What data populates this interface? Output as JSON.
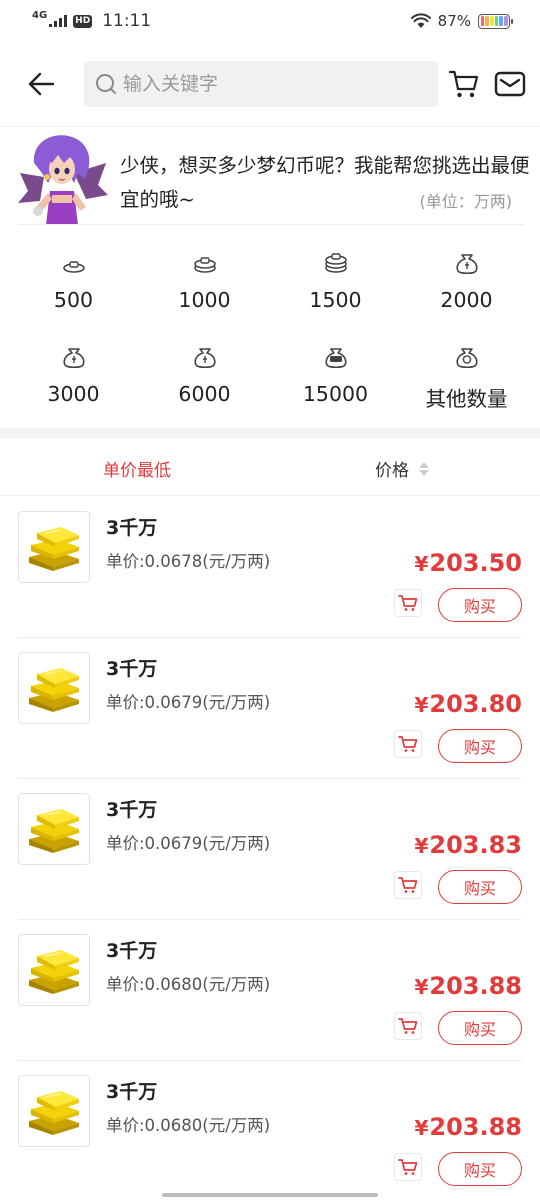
{
  "status_bar": {
    "network": "4G",
    "hd": "HD",
    "time": "11:11",
    "battery": "87%",
    "battery_colors": [
      "#f06a6a",
      "#f3b24a",
      "#f0e24a",
      "#6fcf7a",
      "#5bb0f0",
      "#b68ee8"
    ]
  },
  "header": {
    "search_placeholder": "输入关键字",
    "icons": [
      "back-arrow-icon",
      "search-icon",
      "cart-icon",
      "mail-icon"
    ]
  },
  "banner": {
    "text": "少侠，想买多少梦幻币呢？我能帮您挑选出最便宜的哦~",
    "unit": "(单位：万两)"
  },
  "amounts": [
    {
      "label": "500",
      "icon": "coin-stack-small-icon"
    },
    {
      "label": "1000",
      "icon": "coin-stack-icon"
    },
    {
      "label": "1500",
      "icon": "coin-stack-large-icon"
    },
    {
      "label": "2000",
      "icon": "money-bag-icon"
    },
    {
      "label": "3000",
      "icon": "money-bag-icon"
    },
    {
      "label": "6000",
      "icon": "money-bag-icon"
    },
    {
      "label": "15000",
      "icon": "money-bag-max-icon"
    },
    {
      "label": "其他数量",
      "icon": "money-bag-question-icon"
    }
  ],
  "sort": {
    "lowest_unit": "单价最低",
    "price": "价格"
  },
  "accent_color": "#e23b3b",
  "items": [
    {
      "title": "3千万",
      "unit_price": "单价:0.0678(元/万两)",
      "currency": "¥",
      "price": "203.50",
      "buy": "购买"
    },
    {
      "title": "3千万",
      "unit_price": "单价:0.0679(元/万两)",
      "currency": "¥",
      "price": "203.80",
      "buy": "购买"
    },
    {
      "title": "3千万",
      "unit_price": "单价:0.0679(元/万两)",
      "currency": "¥",
      "price": "203.83",
      "buy": "购买"
    },
    {
      "title": "3千万",
      "unit_price": "单价:0.0680(元/万两)",
      "currency": "¥",
      "price": "203.88",
      "buy": "购买"
    },
    {
      "title": "3千万",
      "unit_price": "单价:0.0680(元/万两)",
      "currency": "¥",
      "price": "203.88",
      "buy": "购买"
    }
  ]
}
